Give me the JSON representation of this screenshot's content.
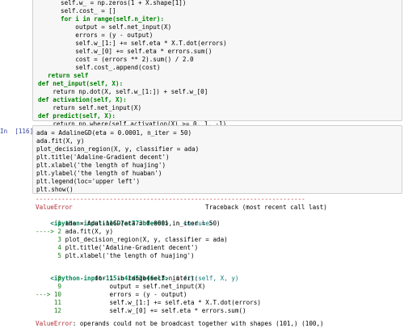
{
  "top_cell": {
    "lines": [
      "self.w_ = np.zeros(1 + X.shape[1])",
      "self.cost_ = []",
      "for i in range(self.n_iter):",
      "    output = self.net_input(X)",
      "    errors = (y - output)",
      "    self.w_[1:] += self.eta * X.T.dot(errors)",
      "    self.w_[0] += self.eta * errors.sum()",
      "    cost = (errors ** 2).sum() / 2.0",
      "    self.cost_.append(cost)",
      "return self",
      "def net_input(self, X):",
      "    return np.dot(X, self.w_[1:]) + self.w_[0]",
      "def activation(self, X):",
      "    return self.net_input(X)",
      "def predict(self, X):",
      "    return np.where(self.activation(X) >= 0, 1, -1)"
    ]
  },
  "main_cell": {
    "prompt": "In  [116]:",
    "lines": [
      "ada = AdalineGD(eta = 0.0001, n_iter = 50)",
      "ada.fit(X, y)",
      "plot_decision_region(X, y, classifier = ada)",
      "plt.title('Adaline-Gradient decent')",
      "plt.xlabel('the length of huajing')",
      "plt.ylabel('the length of huaban')",
      "plt.legend(loc='upper left')",
      "plt.show()"
    ]
  },
  "traceback": {
    "separator": "-------------------------------------------------------------------------",
    "error_name": "ValueError",
    "header_right": "Traceback (most recent call last)",
    "frame1_loc": "<ipython-input-116-7ac773bfee68>",
    "frame1_in": " in ",
    "frame1_module": "<module>",
    "frame1_lines": [
      {
        "prefix": "      1 ",
        "code": "ada = AdalineGD(eta = 0.0001, n_iter = 50)"
      },
      {
        "prefix": "----> 2 ",
        "code": "ada.fit(X, y)"
      },
      {
        "prefix": "      3 ",
        "code": "plot_decision_region(X, y, classifier = ada)"
      },
      {
        "prefix": "      4 ",
        "code": "plt.title('Adaline-Gradient decent')"
      },
      {
        "prefix": "      5 ",
        "code": "plt.xlabel('the length of huajing')"
      }
    ],
    "frame2_loc": "<ipython-input-115-b41d52b46ec3>",
    "frame2_in": " in ",
    "frame2_func": "fit(self, X, y)",
    "frame2_lines": [
      {
        "prefix": "      8 ",
        "code": "        for i in range(self.n_iter):"
      },
      {
        "prefix": "      9 ",
        "code": "            output = self.net_input(X)"
      },
      {
        "prefix": "---> 10 ",
        "code": "            errors = (y - output)"
      },
      {
        "prefix": "     11 ",
        "code": "            self.w_[1:] += self.eta * X.T.dot(errors)"
      },
      {
        "prefix": "     12 ",
        "code": "            self.w_[0] += self.eta * errors.sum()"
      }
    ],
    "final_error_name": "ValueError",
    "final_error_msg": ": operands could not be broadcast together with shapes (101,) (100,)"
  },
  "colors": {
    "prompt": "#303f9f",
    "cell_bg": "#f7f7f7",
    "error_red": "#b22b31",
    "keyword_green": "#008000",
    "string_red": "#ba2121"
  }
}
